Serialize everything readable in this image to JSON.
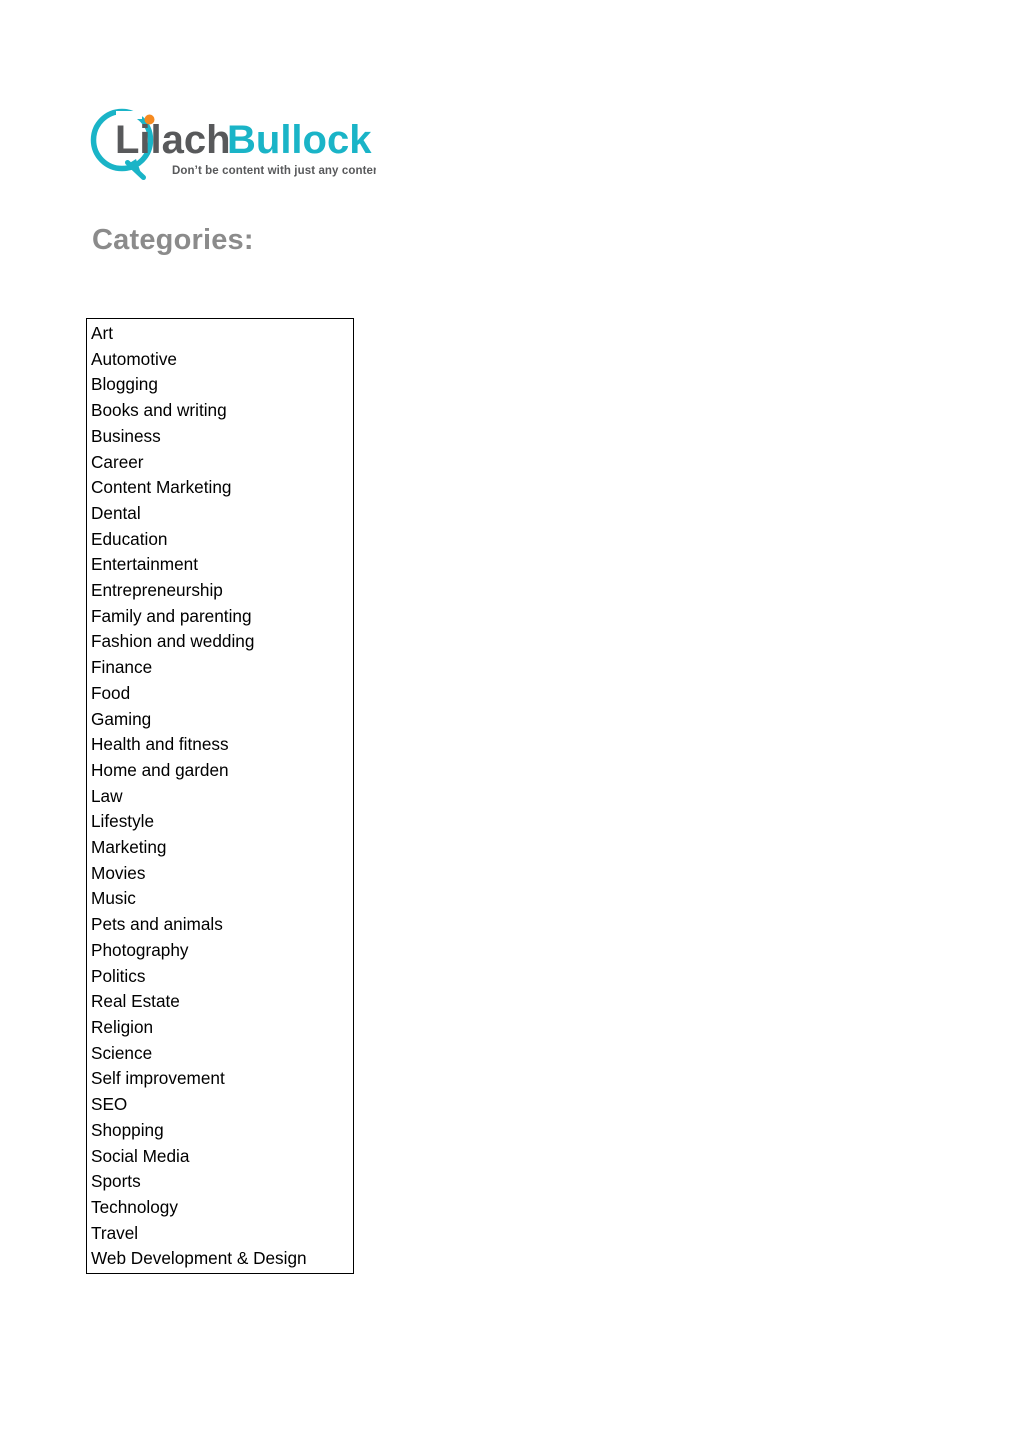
{
  "document": {
    "background_color": "#ffffff"
  },
  "logo": {
    "name": "lilach-bullock-logo",
    "word_primary": "Lilach",
    "word_secondary": "Bullock",
    "tagline": "Don't be content with just any content.",
    "colors": {
      "teal": "#1ab4c7",
      "dark_gray": "#58595b",
      "orange": "#f68a1f"
    }
  },
  "heading": {
    "text": "Categories:",
    "color": "#8b8b8b"
  },
  "categories": {
    "label": "Categories list",
    "border_color": "#000000",
    "items": [
      "Art",
      "Automotive",
      "Blogging",
      "Books and writing",
      "Business",
      "Career",
      "Content Marketing",
      "Dental",
      "Education",
      "Entertainment",
      "Entrepreneurship",
      "Family and parenting",
      "Fashion and wedding",
      "Finance",
      "Food",
      "Gaming",
      "Health and fitness",
      "Home and garden",
      "Law",
      "Lifestyle",
      "Marketing",
      "Movies",
      "Music",
      "Pets and animals",
      "Photography",
      "Politics",
      "Real Estate",
      "Religion",
      "Science",
      "Self improvement",
      "SEO",
      "Shopping",
      "Social Media",
      "Sports",
      "Technology",
      "Travel",
      "Web Development & Design"
    ]
  }
}
